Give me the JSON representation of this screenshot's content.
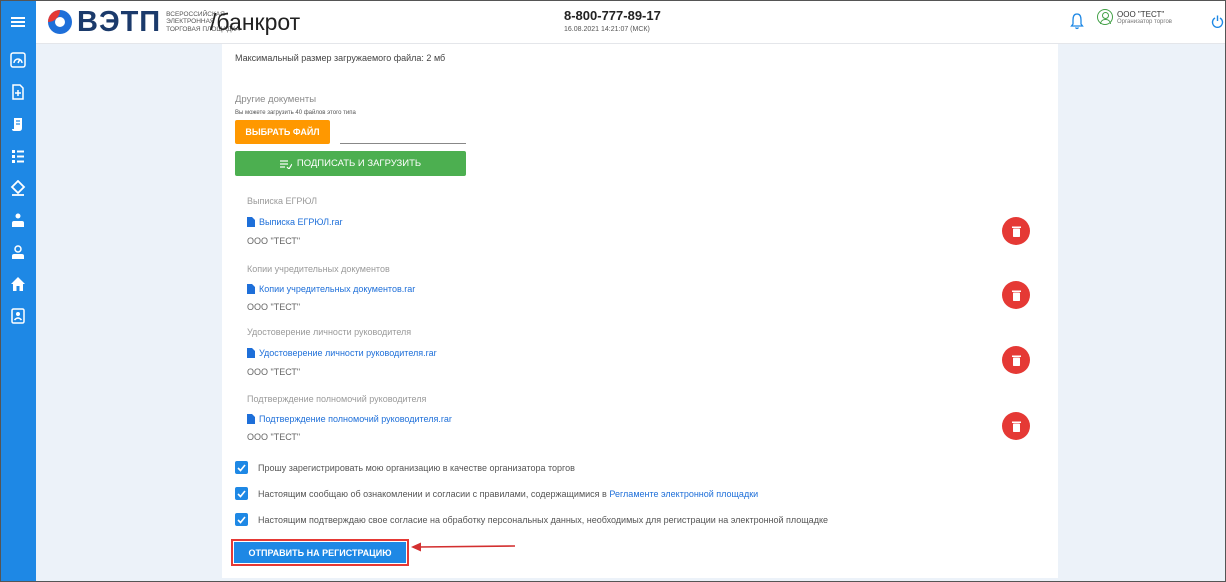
{
  "header": {
    "logo_text": "ВЭТП",
    "logo_sub": [
      "ВСЕРОССИЙСКАЯ",
      "ЭЛЕКТРОННАЯ",
      "ТОРГОВАЯ ПЛОЩАДКА"
    ],
    "section": "/банкрот",
    "phone": "8-800-777-89-17",
    "datetime": "16.08.2021 14:21:07 (МСК)",
    "account_name": "ООО \"ТЕСТ\"",
    "account_role": "Организатор торгов"
  },
  "colors": {
    "accent_blue": "#1e88e5",
    "orange": "#ff9800",
    "green": "#4caf50",
    "red": "#e53935",
    "link": "#1e6fd9"
  },
  "sidebar": {
    "icons": [
      "gauge-icon",
      "document-plus-icon",
      "scroll-icon",
      "list-icon",
      "gavel-icon",
      "person-up-icon",
      "person-down-icon",
      "home-icon",
      "contacts-icon"
    ]
  },
  "upload": {
    "max_size": "Максимальный размер загружаемого файла: 2 мб",
    "other_docs_label": "Другие документы",
    "other_docs_note": "Вы можете загрузить 40 файлов этого типа",
    "choose_file": "ВЫБРАТЬ ФАЙЛ",
    "sign_upload": "ПОДПИСАТЬ И ЗАГРУЗИТЬ"
  },
  "documents": [
    {
      "title": "Выписка ЕГРЮЛ",
      "file": "Выписка ЕГРЮЛ.rar",
      "owner": "ООО \"ТЕСТ\""
    },
    {
      "title": "Копии учредительных документов",
      "file": "Копии учредительных документов.rar",
      "owner": "ООО \"ТЕСТ\""
    },
    {
      "title": "Удостоверение личности руководителя",
      "file": "Удостоверение личности руководителя.rar",
      "owner": "ООО \"ТЕСТ\""
    },
    {
      "title": "Подтверждение полномочий руководителя",
      "file": "Подтверждение полномочий руководителя.rar",
      "owner": "ООО \"ТЕСТ\""
    }
  ],
  "agreements": {
    "register_text": "Прошу зарегистрировать мою организацию в качестве организатора торгов",
    "rules_text": "Настоящим сообщаю об ознакомлении и согласии с правилами, содержащимися в",
    "rules_link": "Регламенте электронной площадки",
    "personal_text": "Настоящим подтверждаю свое согласие на обработку персональных данных, необходимых для регистрации на электронной площадке"
  },
  "submit_label": "ОТПРАВИТЬ НА РЕГИСТРАЦИЮ"
}
